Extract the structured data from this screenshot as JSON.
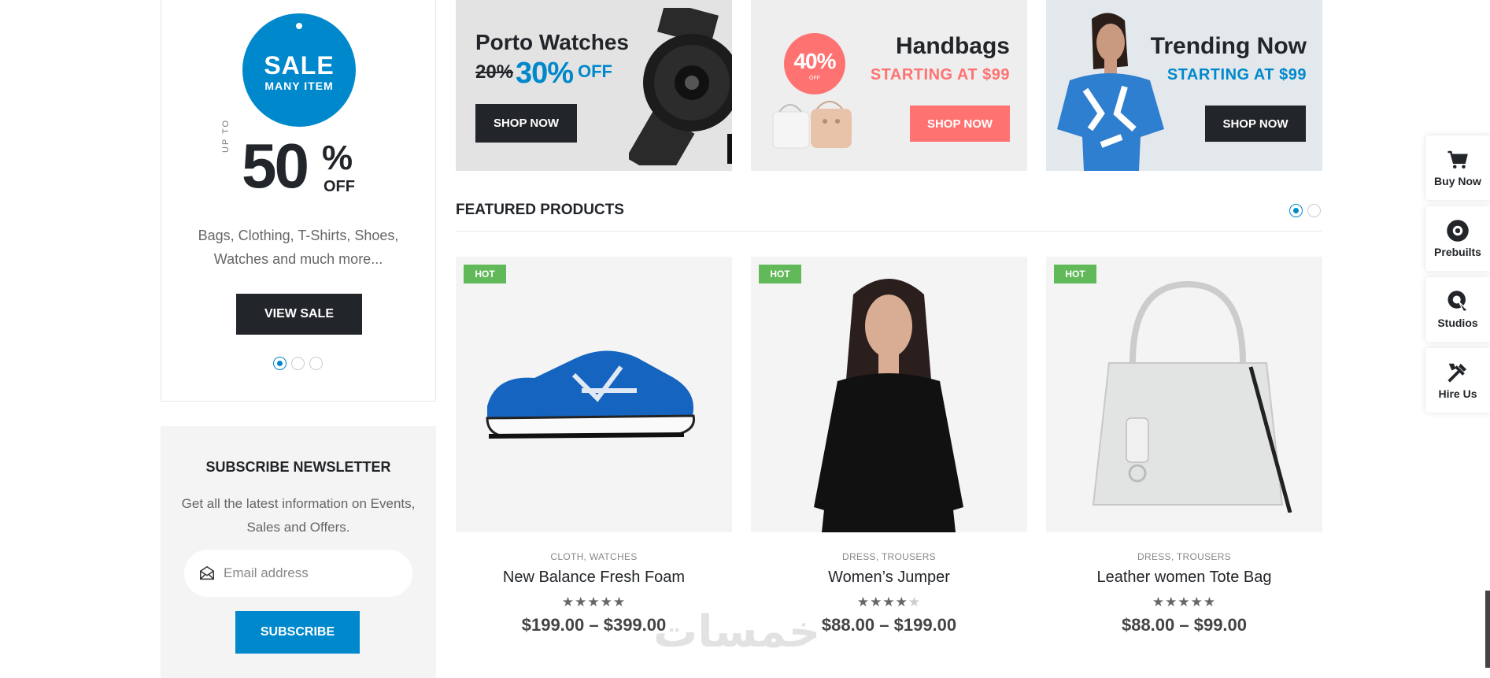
{
  "sale_box": {
    "tag_big": "SALE",
    "tag_small": "MANY ITEM",
    "upto": "UP TO",
    "percent_number": "50",
    "percent_sign": "%",
    "percent_off": "OFF",
    "description": "Bags, Clothing, T-Shirts, Shoes, Watches and much more...",
    "button": "VIEW SALE",
    "slider_dots": 3,
    "active_dot": 0
  },
  "newsletter": {
    "title": "SUBSCRIBE NEWSLETTER",
    "description": "Get all the latest information on Events, Sales and Offers.",
    "email_placeholder": "Email address",
    "button": "SUBSCRIBE"
  },
  "banners": [
    {
      "title": "Porto Watches",
      "old_pct": "20%",
      "new_pct": "30%",
      "off": "OFF",
      "button": "SHOP NOW"
    },
    {
      "badge_value": "40%",
      "badge_sub": "OFF",
      "title": "Handbags",
      "subtitle": "STARTING AT $99",
      "button": "SHOP NOW"
    },
    {
      "title": "Trending Now",
      "subtitle": "STARTING AT $99",
      "button": "SHOP NOW"
    }
  ],
  "featured": {
    "title": "FEATURED PRODUCTS",
    "slider_dots": 2,
    "active_dot": 0
  },
  "products": [
    {
      "badge": "HOT",
      "category": "CLOTH, WATCHES",
      "name": "New Balance Fresh Foam",
      "rating": 5,
      "price": "$199.00 – $399.00",
      "image": "blue-sneaker"
    },
    {
      "badge": "HOT",
      "category": "DRESS, TROUSERS",
      "name": "Women’s Jumper",
      "rating": 4,
      "price": "$88.00 – $199.00",
      "image": "woman-black-jumper"
    },
    {
      "badge": "HOT",
      "category": "DRESS, TROUSERS",
      "name": "Leather women Tote Bag",
      "rating": 5,
      "price": "$88.00 – $99.00",
      "image": "white-tote-bag"
    }
  ],
  "tools": [
    {
      "label": "Buy Now",
      "icon": "cart-icon"
    },
    {
      "label": "Prebuilts",
      "icon": "disc-icon"
    },
    {
      "label": "Studios",
      "icon": "pointer-icon"
    },
    {
      "label": "Hire Us",
      "icon": "tools-icon"
    }
  ],
  "colors": {
    "primary": "#0088cc",
    "dark": "#222529",
    "pink": "#ff7272",
    "hot": "#62b959"
  }
}
